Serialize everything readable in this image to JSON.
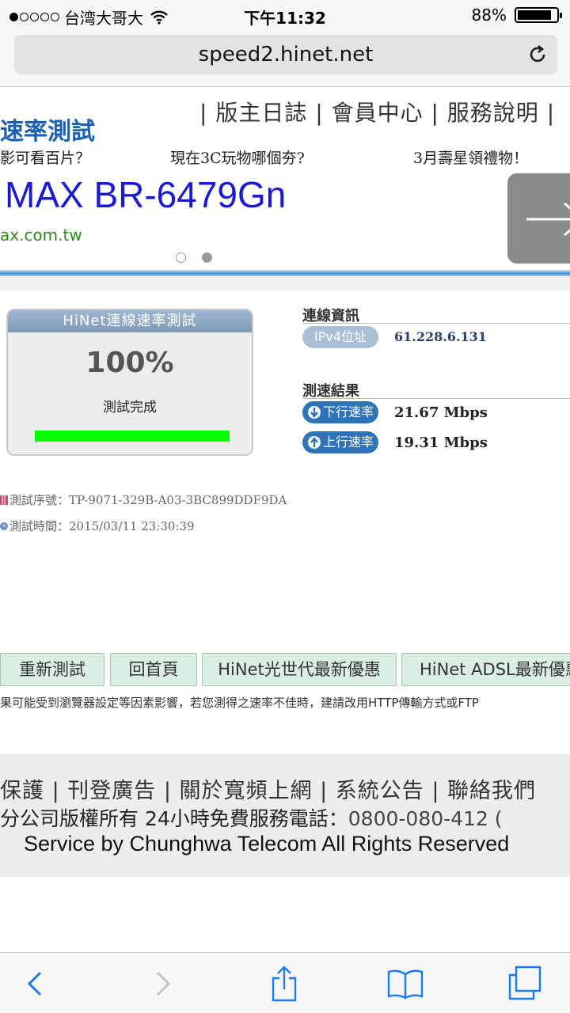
{
  "status_bar": {
    "carrier": "台湾大哥大",
    "time": "下午11:32",
    "battery_pct": "88%",
    "battery_level": 0.88,
    "signal_bars_filled": 1,
    "signal_bars_total": 5
  },
  "address_bar": {
    "url": "speed2.hinet.net"
  },
  "site_header": {
    "site_title": "速率測試",
    "top_links": "| 版主日誌 | 會員中心 | 服務說明 |"
  },
  "banner": {
    "promos": [
      "影可看百片？",
      "現在3C玩物哪個夯?",
      "3月壽星領禮物！"
    ],
    "ad_title": "MAX BR-6479Gn",
    "ad_url": "ax.com.tw",
    "pager_count": 2,
    "pager_active": 1
  },
  "speed_box": {
    "header": "HiNet連線速率測試",
    "percent": "100%",
    "status": "測試完成",
    "progress": 1.0,
    "progress_color": "#00ff00"
  },
  "connection": {
    "section_label": "連線資訊",
    "ip_label": "IPv4位址",
    "ip_value": "61.228.6.131"
  },
  "results": {
    "section_label": "測速結果",
    "download_label": "下行速率",
    "download_value": "21.67 Mbps",
    "upload_label": "上行速率",
    "upload_value": "19.31 Mbps"
  },
  "meta": {
    "serial": "測試序號：TP-9071-329B-A03-3BC899DDF9DA",
    "time": "測試時間：2015/03/11 23:30:39"
  },
  "buttons": [
    "重新測試",
    "回首頁",
    "HiNet光世代最新優惠",
    "HiNet ADSL最新優惠"
  ],
  "notice": "果可能受到瀏覽器設定等因素影響，若您測得之速率不佳時，建請改用HTTP傳輸方式或FTP",
  "footer": {
    "links": "保護 | 刊登廣告 | 關於寬頻上網 | 系統公告 | 聯絡我們",
    "rights_prefix": "分公司版權所有 24小時免費服務電話：",
    "phone": "0800-080-412 (",
    "service": "Service by Chunghwa Telecom All Rights Reserved"
  },
  "colors": {
    "link_blue": "#1a5fb8",
    "ad_blue": "#1a1ad0",
    "ad_green": "#2a8a1a",
    "pill_blue": "#2f73b8",
    "button_green": "#dbeee1"
  },
  "toolbar": {
    "icons": [
      "back-icon",
      "forward-icon",
      "share-icon",
      "bookmarks-icon",
      "tabs-icon"
    ]
  }
}
